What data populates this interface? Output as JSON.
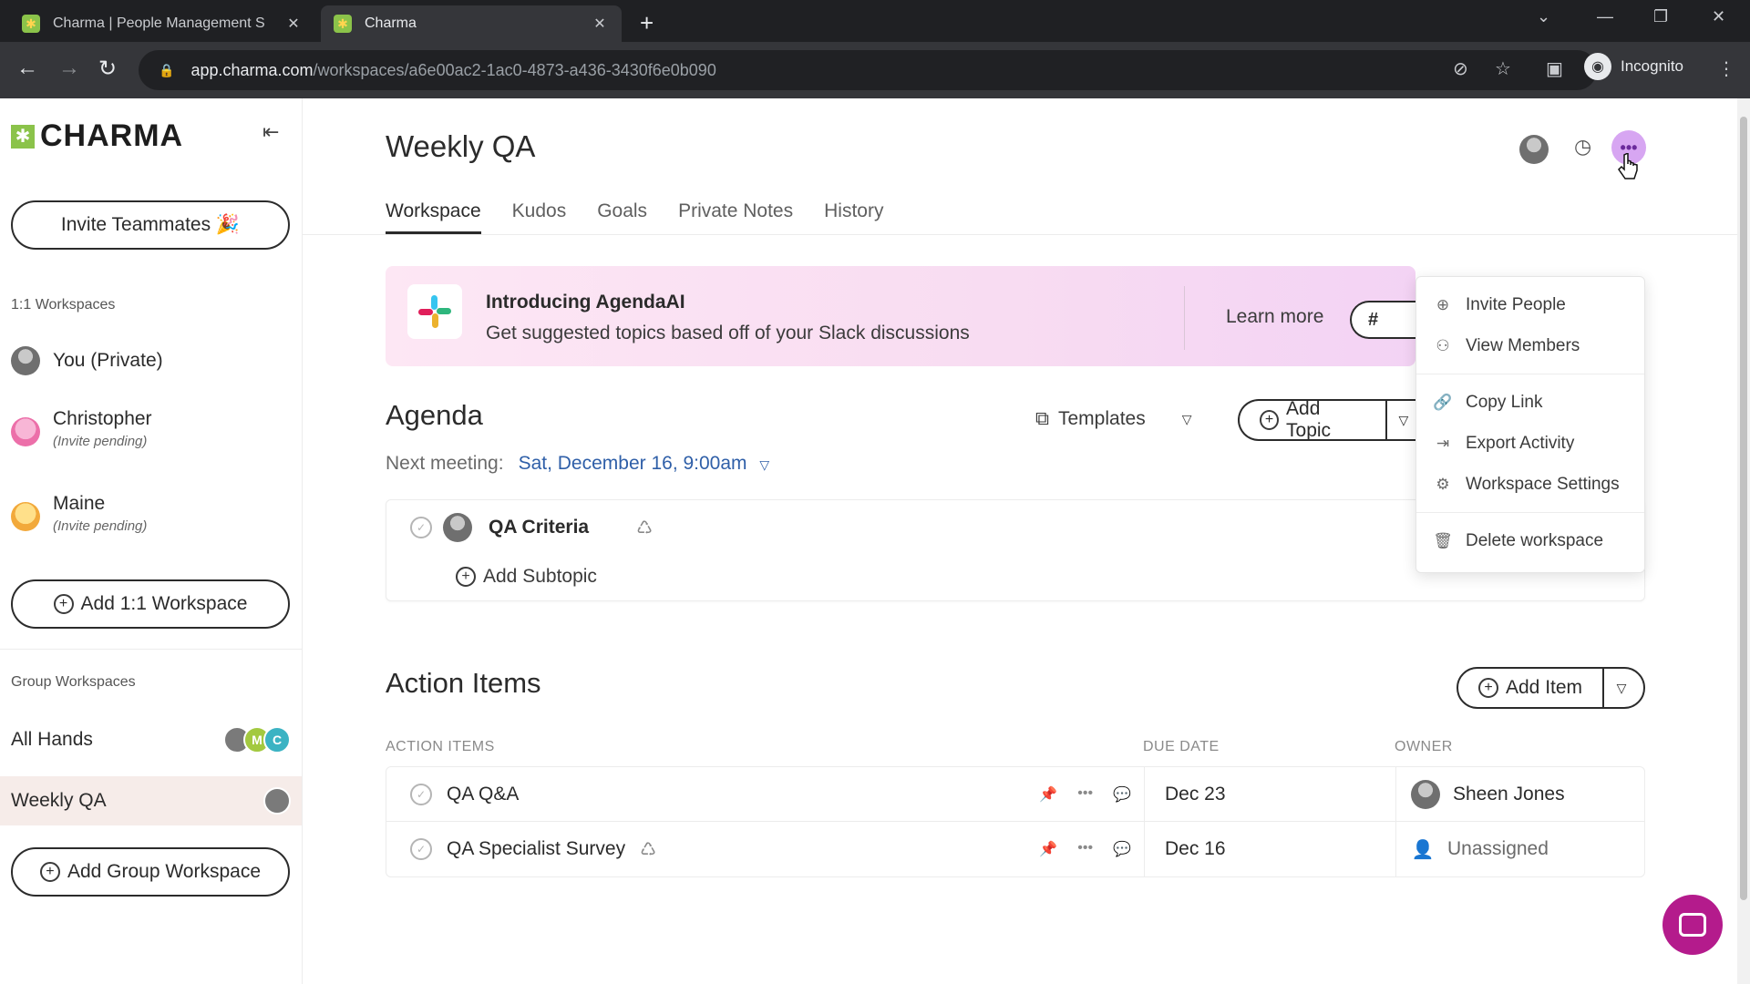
{
  "browser": {
    "tabs": [
      {
        "title": "Charma | People Management S",
        "active": false
      },
      {
        "title": "Charma",
        "active": true
      }
    ],
    "url_host": "app.charma.com",
    "url_path": "/workspaces/a6e00ac2-1ac0-4873-a436-3430f6e0b090",
    "incognito_label": "Incognito"
  },
  "sidebar": {
    "logo": "CHARMA",
    "invite_button": "Invite Teammates 🎉",
    "one_on_one_section": "1:1 Workspaces",
    "one_on_one_items": [
      {
        "name": "You (Private)",
        "sub": ""
      },
      {
        "name": "Christopher",
        "sub": "(Invite pending)"
      },
      {
        "name": "Maine",
        "sub": "(Invite pending)"
      }
    ],
    "add_one_on_one": "Add 1:1 Workspace",
    "group_section": "Group Workspaces",
    "group_items": [
      {
        "name": "All Hands",
        "avatars": [
          "",
          "M",
          "C"
        ]
      },
      {
        "name": "Weekly QA",
        "avatars": [
          ""
        ]
      }
    ],
    "add_group": "Add Group Workspace"
  },
  "main": {
    "title": "Weekly QA",
    "tabs": [
      "Workspace",
      "Kudos",
      "Goals",
      "Private Notes",
      "History"
    ],
    "banner": {
      "title": "Introducing AgendaAI",
      "subtitle": "Get suggested topics based off of your Slack discussions",
      "learn_more": "Learn more"
    },
    "agenda": {
      "title": "Agenda",
      "next_meeting_label": "Next meeting:",
      "next_meeting_date": "Sat, December 16, 9:00am",
      "templates": "Templates",
      "add_topic": "Add Topic",
      "topics": [
        {
          "title": "QA Criteria"
        }
      ],
      "add_subtopic": "Add Subtopic"
    },
    "action_items": {
      "title": "Action Items",
      "add_item": "Add Item",
      "columns": [
        "ACTION ITEMS",
        "DUE DATE",
        "OWNER"
      ],
      "rows": [
        {
          "title": "QA Q&A",
          "due": "Dec 23",
          "owner": "Sheen Jones",
          "assigned": true,
          "recurring": false
        },
        {
          "title": "QA Specialist Survey",
          "due": "Dec 16",
          "owner": "Unassigned",
          "assigned": false,
          "recurring": true
        }
      ]
    }
  },
  "menu": {
    "items": [
      {
        "label": "Invite People",
        "icon": "add-person-icon"
      },
      {
        "label": "View Members",
        "icon": "people-icon"
      },
      {
        "label": "Copy Link",
        "icon": "link-icon"
      },
      {
        "label": "Export Activity",
        "icon": "export-icon"
      },
      {
        "label": "Workspace Settings",
        "icon": "gear-icon"
      },
      {
        "label": "Delete workspace",
        "icon": "trash-icon"
      }
    ]
  },
  "colors": {
    "accent_purple": "#d7a6f2",
    "brand_green": "#8bc34a",
    "link_blue": "#2f5fa8",
    "chat_magenta": "#b41b8c"
  }
}
